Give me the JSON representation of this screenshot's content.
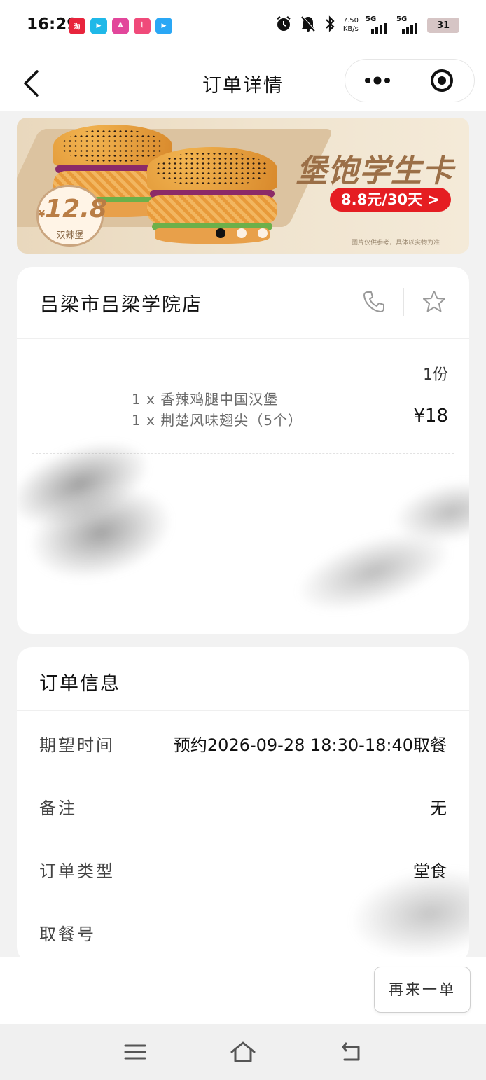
{
  "status_bar": {
    "time": "16:29",
    "app_icons": [
      {
        "name": "app-icon-red",
        "color": "#e8243c",
        "glyph": "淘"
      },
      {
        "name": "app-icon-video",
        "color": "#1fb8e8",
        "glyph": "▶"
      },
      {
        "name": "app-icon-game",
        "color": "#e2469b",
        "glyph": "A"
      },
      {
        "name": "app-icon-pink",
        "color": "#f04a7a",
        "glyph": "ᥣ"
      },
      {
        "name": "app-icon-play",
        "color": "#2aa7f5",
        "glyph": "▶"
      }
    ],
    "network_speed_value": "7.50",
    "network_speed_unit": "KB/s",
    "signal_1": "5G",
    "signal_2": "5G",
    "battery": "31"
  },
  "header": {
    "title": "订单详情"
  },
  "banner": {
    "price": "12.8",
    "price_currency": "¥",
    "price_name": "双辣堡",
    "title": "堡饱学生卡",
    "cta": "8.8元/30天 >",
    "disclaimer": "图片仅供参考，具体以实物为准",
    "slide_count": 3,
    "active_slide": 1
  },
  "store": {
    "name": "吕梁市吕梁学院店",
    "quantity": "1份",
    "items": [
      "1 x  香辣鸡腿中国汉堡",
      "1 x  荆楚风味翅尖（5个）"
    ],
    "price": "¥18"
  },
  "order_info": {
    "title": "订单信息",
    "rows": [
      {
        "label": "期望时间",
        "value": "预约2026-09-28 18:30-18:40取餐"
      },
      {
        "label": "备注",
        "value": "无"
      },
      {
        "label": "订单类型",
        "value": "堂食"
      },
      {
        "label": "取餐号",
        "value": ""
      }
    ]
  },
  "actions": {
    "reorder": "再来一单"
  },
  "colors": {
    "accent_red": "#e51d22",
    "banner_brown": "#9b6f47"
  }
}
